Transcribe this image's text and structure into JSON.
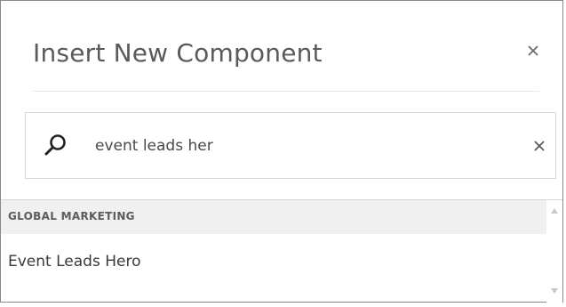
{
  "dialog": {
    "title": "Insert New Component"
  },
  "search": {
    "value": "event leads her",
    "placeholder": ""
  },
  "results": {
    "groups": [
      {
        "label": "GLOBAL MARKETING",
        "items": [
          {
            "label": "Event Leads Hero"
          }
        ]
      }
    ]
  },
  "icons": {
    "close": "close-icon",
    "search": "search-icon",
    "clear": "clear-icon",
    "scroll_up": "scroll-up-arrow-icon",
    "scroll_down": "scroll-down-arrow-icon"
  },
  "colors": {
    "title": "#5a5a5a",
    "border": "#8a8a8a",
    "group_bg": "#f0f0f0"
  }
}
